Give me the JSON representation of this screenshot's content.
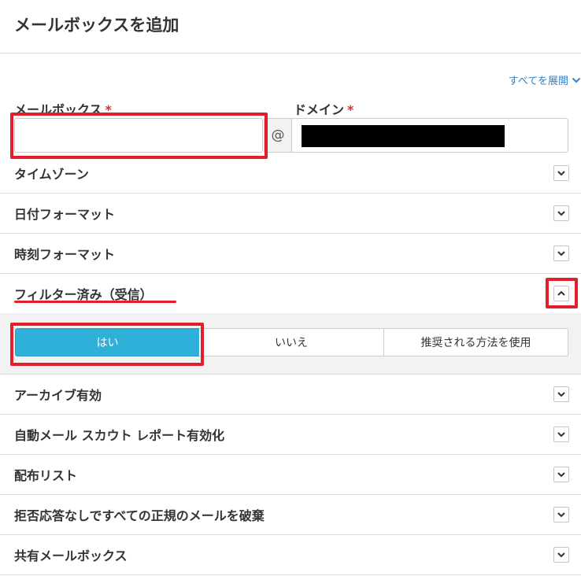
{
  "dialog": {
    "title": "メールボックスを追加"
  },
  "expand_all": {
    "label": "すべてを展開"
  },
  "fields": {
    "mailbox": {
      "label": "メールボックス",
      "required_mark": "*",
      "value": ""
    },
    "at_sign": "@",
    "domain": {
      "label": "ドメイン",
      "required_mark": "*"
    }
  },
  "sections": {
    "timezone": "タイムゾーン",
    "date_format": "日付フォーマット",
    "time_format": "時刻フォーマット",
    "filtered_inbound": "フィルター済み（受信）",
    "archive": "アーカイブ有効",
    "scout_report": "自動メール スカウト レポート有効化",
    "distribution_list": "配布リスト",
    "discard_mail": "拒否応答なしですべての正規のメールを破棄",
    "shared_mailbox": "共有メールボックス"
  },
  "filter_options": {
    "selected": "はい",
    "yes": "はい",
    "no": "いいえ",
    "recommended": "推奨される方法を使用"
  },
  "colors": {
    "accent_blue": "#2eb0d8",
    "link_blue": "#3a80c2",
    "highlight_red": "#e0202a",
    "required_red": "#cc3333"
  }
}
